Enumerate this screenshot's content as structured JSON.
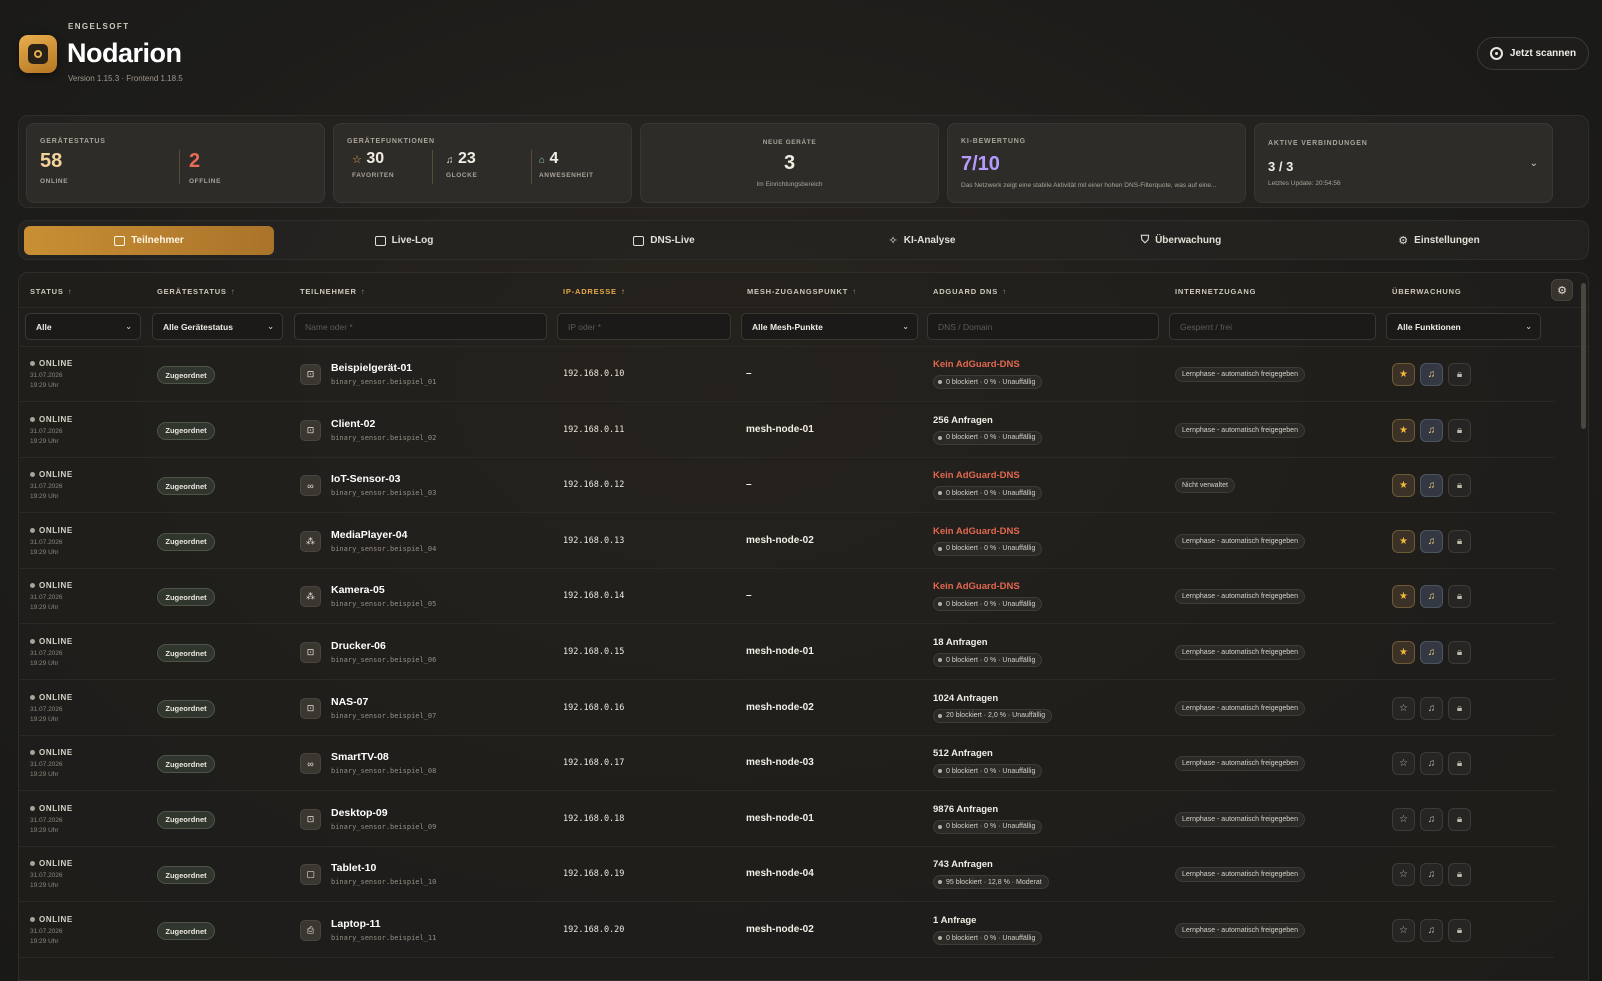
{
  "header": {
    "vendor": "ENGELSOFT",
    "app_name": "Nodarion",
    "version": "Version 1.15.3 · Frontend 1.18.5",
    "scan_button": "Jetzt scannen"
  },
  "stats": {
    "geraetestatus": {
      "label": "GERÄTESTATUS",
      "online_value": "58",
      "online_label": "ONLINE",
      "offline_value": "2",
      "offline_label": "OFFLINE"
    },
    "geraetefunktionen": {
      "label": "GERÄTEFUNKTIONEN",
      "favoriten_value": "30",
      "favoriten_label": "FAVORITEN",
      "glocke_value": "23",
      "glocke_label": "GLOCKE",
      "anwesenheit_value": "4",
      "anwesenheit_label": "ANWESENHEIT"
    },
    "neue_geraete": {
      "label": "NEUE GERÄTE",
      "value": "3",
      "sub": "Im Einrichtungsbereich"
    },
    "ki_bewertung": {
      "label": "KI-BEWERTUNG",
      "value": "7/10",
      "text": "Das Netzwerk zeigt eine stabile Aktivität mit einer hohen DNS-Filterquote, was auf eine..."
    },
    "aktive_verbindungen": {
      "label": "AKTIVE VERBINDUNGEN",
      "value": "3 / 3",
      "sub": "Letztes Update: 20:54:56"
    }
  },
  "tabs": [
    {
      "label": "Teilnehmer",
      "active": true
    },
    {
      "label": "Live-Log",
      "active": false
    },
    {
      "label": "DNS-Live",
      "active": false
    },
    {
      "label": "KI-Analyse",
      "active": false
    },
    {
      "label": "Überwachung",
      "active": false
    },
    {
      "label": "Einstellungen",
      "active": false
    }
  ],
  "table": {
    "headers": {
      "status": "STATUS",
      "geraetestatus": "GERÄTESTATUS",
      "teilnehmer": "TEILNEHMER",
      "ip": "IP-ADRESSE",
      "mesh": "MESH-ZUGANGSPUNKT",
      "adguard": "ADGUARD DNS",
      "internet": "INTERNETZUGANG",
      "ueberwachung": "ÜBERWACHUNG"
    },
    "filters": {
      "status": "Alle",
      "geraetestatus": "Alle Gerätestatus",
      "teilnehmer_placeholder": "Name oder *",
      "ip_placeholder": "IP oder *",
      "mesh": "Alle Mesh-Punkte",
      "dns_placeholder": "DNS / Domain",
      "internet_placeholder": "Gesperrt / frei",
      "ueberwachung": "Alle Funktionen"
    },
    "rows": [
      {
        "status": "ONLINE",
        "date": "31.07.2026",
        "time": "19:29 Uhr",
        "badge": "Zugeordnet",
        "icon": "⊡",
        "name": "Beispielgerät-01",
        "entity": "binary_sensor.beispiel_01",
        "ip": "192.168.0.10",
        "mesh": "–",
        "dns": "Kein AdGuard-DNS",
        "dns_warn": true,
        "dns_stats": "0 blockiert · 0 % · Unauffällig",
        "internet": "Lernphase - automatisch freigegeben",
        "star": true,
        "bell": true
      },
      {
        "status": "ONLINE",
        "date": "31.07.2026",
        "time": "19:29 Uhr",
        "badge": "Zugeordnet",
        "icon": "⊡",
        "name": "Client-02",
        "entity": "binary_sensor.beispiel_02",
        "ip": "192.168.0.11",
        "mesh": "mesh-node-01",
        "dns": "256 Anfragen",
        "dns_warn": false,
        "dns_stats": "0 blockiert · 0 % · Unauffällig",
        "internet": "Lernphase - automatisch freigegeben",
        "star": true,
        "bell": true
      },
      {
        "status": "ONLINE",
        "date": "31.07.2026",
        "time": "19:29 Uhr",
        "badge": "Zugeordnet",
        "icon": "∞",
        "name": "IoT-Sensor-03",
        "entity": "binary_sensor.beispiel_03",
        "ip": "192.168.0.12",
        "mesh": "–",
        "dns": "Kein AdGuard-DNS",
        "dns_warn": true,
        "dns_stats": "0 blockiert · 0 % · Unauffällig",
        "internet": "Nicht verwaltet",
        "star": true,
        "bell": true
      },
      {
        "status": "ONLINE",
        "date": "31.07.2026",
        "time": "19:29 Uhr",
        "badge": "Zugeordnet",
        "icon": "⁂",
        "name": "MediaPlayer-04",
        "entity": "binary_sensor.beispiel_04",
        "ip": "192.168.0.13",
        "mesh": "mesh-node-02",
        "dns": "Kein AdGuard-DNS",
        "dns_warn": true,
        "dns_stats": "0 blockiert · 0 % · Unauffällig",
        "internet": "Lernphase - automatisch freigegeben",
        "star": true,
        "bell": true
      },
      {
        "status": "ONLINE",
        "date": "31.07.2026",
        "time": "19:29 Uhr",
        "badge": "Zugeordnet",
        "icon": "⁂",
        "name": "Kamera-05",
        "entity": "binary_sensor.beispiel_05",
        "ip": "192.168.0.14",
        "mesh": "–",
        "dns": "Kein AdGuard-DNS",
        "dns_warn": true,
        "dns_stats": "0 blockiert · 0 % · Unauffällig",
        "internet": "Lernphase - automatisch freigegeben",
        "star": true,
        "bell": true
      },
      {
        "status": "ONLINE",
        "date": "31.07.2026",
        "time": "19:29 Uhr",
        "badge": "Zugeordnet",
        "icon": "⊡",
        "name": "Drucker-06",
        "entity": "binary_sensor.beispiel_06",
        "ip": "192.168.0.15",
        "mesh": "mesh-node-01",
        "dns": "18 Anfragen",
        "dns_warn": false,
        "dns_stats": "0 blockiert · 0 % · Unauffällig",
        "internet": "Lernphase - automatisch freigegeben",
        "star": true,
        "bell": true
      },
      {
        "status": "ONLINE",
        "date": "31.07.2026",
        "time": "19:29 Uhr",
        "badge": "Zugeordnet",
        "icon": "⊡",
        "name": "NAS-07",
        "entity": "binary_sensor.beispiel_07",
        "ip": "192.168.0.16",
        "mesh": "mesh-node-02",
        "dns": "1024 Anfragen",
        "dns_warn": false,
        "dns_stats": "20 blockiert · 2,0 % · Unauffällig",
        "internet": "Lernphase - automatisch freigegeben",
        "star": false,
        "bell": false
      },
      {
        "status": "ONLINE",
        "date": "31.07.2026",
        "time": "19:29 Uhr",
        "badge": "Zugeordnet",
        "icon": "∞",
        "name": "SmartTV-08",
        "entity": "binary_sensor.beispiel_08",
        "ip": "192.168.0.17",
        "mesh": "mesh-node-03",
        "dns": "512 Anfragen",
        "dns_warn": false,
        "dns_stats": "0 blockiert · 0 % · Unauffällig",
        "internet": "Lernphase - automatisch freigegeben",
        "star": false,
        "bell": false
      },
      {
        "status": "ONLINE",
        "date": "31.07.2026",
        "time": "19:29 Uhr",
        "badge": "Zugeordnet",
        "icon": "⊡",
        "name": "Desktop-09",
        "entity": "binary_sensor.beispiel_09",
        "ip": "192.168.0.18",
        "mesh": "mesh-node-01",
        "dns": "9876 Anfragen",
        "dns_warn": false,
        "dns_stats": "0 blockiert · 0 % · Unauffällig",
        "internet": "Lernphase - automatisch freigegeben",
        "star": false,
        "bell": false
      },
      {
        "status": "ONLINE",
        "date": "31.07.2026",
        "time": "19:29 Uhr",
        "badge": "Zugeordnet",
        "icon": "▢",
        "name": "Tablet-10",
        "entity": "binary_sensor.beispiel_10",
        "ip": "192.168.0.19",
        "mesh": "mesh-node-04",
        "dns": "743 Anfragen",
        "dns_warn": false,
        "dns_stats": "95 blockiert · 12,8 % · Moderat",
        "internet": "Lernphase - automatisch freigegeben",
        "star": false,
        "bell": false
      },
      {
        "status": "ONLINE",
        "date": "31.07.2026",
        "time": "19:29 Uhr",
        "badge": "Zugeordnet",
        "icon": "⎙",
        "name": "Laptop-11",
        "entity": "binary_sensor.beispiel_11",
        "ip": "192.168.0.20",
        "mesh": "mesh-node-02",
        "dns": "1 Anfrage",
        "dns_warn": false,
        "dns_stats": "0 blockiert · 0 % · Unauffällig",
        "internet": "Lernphase - automatisch freigegeben",
        "star": false,
        "bell": false
      }
    ]
  }
}
